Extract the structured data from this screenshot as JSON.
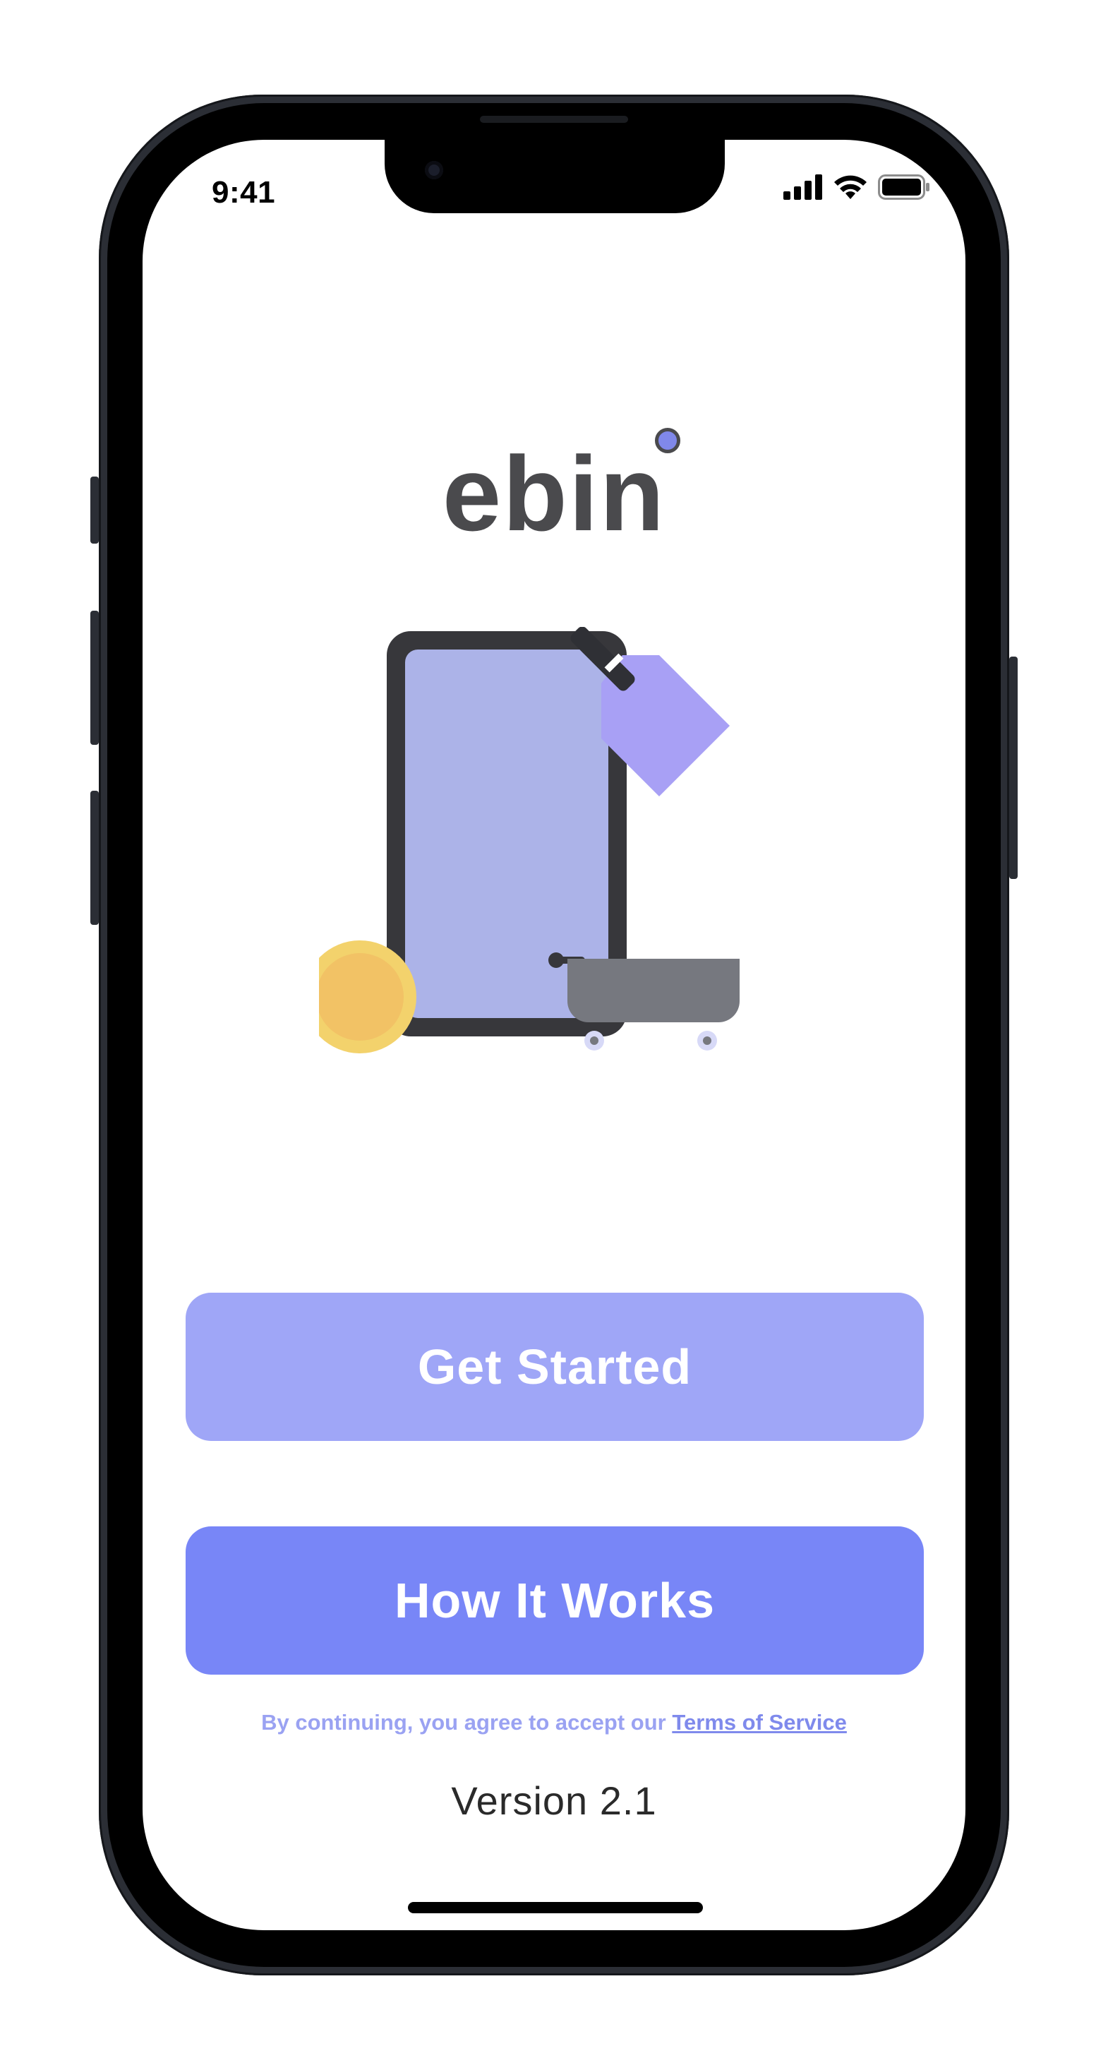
{
  "status_bar": {
    "time": "9:41",
    "signal_icon": "cellular-signal-icon",
    "wifi_icon": "wifi-icon",
    "battery_icon": "battery-icon"
  },
  "app": {
    "logo_text": "ebin"
  },
  "illustration": {
    "icons": [
      "phone-icon",
      "price-tag-icon",
      "coin-icon",
      "shopping-cart-icon"
    ]
  },
  "actions": {
    "get_started_label": "Get Started",
    "how_it_works_label": "How It Works"
  },
  "legal": {
    "prefix": "By continuing, you agree to accept our ",
    "link_label": "Terms of Service"
  },
  "footer": {
    "version": "Version 2.1"
  },
  "colors": {
    "primary_light": "#9fa6f7",
    "primary": "#7886f7",
    "logo_text": "#4a4a4d",
    "accent_dot": "#8088ea",
    "coin": "#f2c265",
    "tag": "#a8a0f5"
  }
}
